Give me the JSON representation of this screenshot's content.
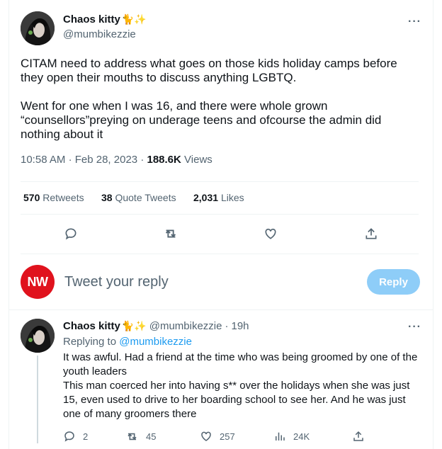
{
  "main_tweet": {
    "author": {
      "name": "Chaos kitty",
      "name_emoji": "🐈✨",
      "handle": "@mumbikezzie"
    },
    "paragraphs": [
      "CITAM need to address what goes on those kids holiday camps before they open their mouths to discuss anything LGBTQ.",
      "Went for one when I was 16, and there were whole grown “counsellors”preying on underage teens and ofcourse the admin did nothing about it"
    ],
    "time": "10:58 AM",
    "sep1": "·",
    "date": "Feb 28, 2023",
    "sep2": "·",
    "views_count": "188.6K",
    "views_label": "Views",
    "stats": {
      "retweets_count": "570",
      "retweets_label": "Retweets",
      "quotes_count": "38",
      "quotes_label": "Quote Tweets",
      "likes_count": "2,031",
      "likes_label": "Likes"
    },
    "icons": [
      "reply-icon",
      "retweet-icon",
      "like-icon",
      "share-icon"
    ]
  },
  "compose": {
    "avatar_text": "NW",
    "avatar_color": "#e0121d",
    "placeholder": "Tweet your reply",
    "button_label": "Reply",
    "button_color": "#8ecdf8"
  },
  "reply_tweet": {
    "author": {
      "name": "Chaos kitty",
      "name_emoji": "🐈✨",
      "handle": "@mumbikezzie",
      "sep": "·",
      "time": "19h"
    },
    "replying_label": "Replying to",
    "replying_handle": "@mumbikezzie",
    "lines": [
      "It was awful. Had a friend at the time who was being groomed by one of the youth leaders",
      "This man coerced her into having s** over the holidays when she was just 15, even used to drive to her boarding school to see her. And he was just one of many groomers there"
    ],
    "actions": {
      "reply_count": "2",
      "retweet_count": "45",
      "like_count": "257",
      "views_count": "24K"
    }
  },
  "more_label": "···"
}
